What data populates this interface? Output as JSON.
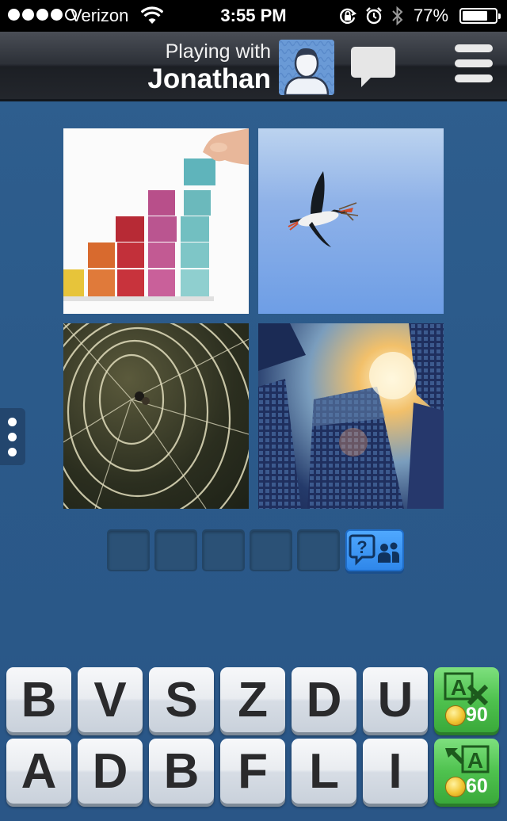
{
  "status_bar": {
    "carrier": "Verizon",
    "time": "3:55 PM",
    "battery_text": "77%",
    "battery_level": 0.77,
    "signal_dots": 4,
    "signal_total": 5
  },
  "header": {
    "playing_with_label": "Playing with",
    "opponent_name": "Jonathan",
    "icons": [
      "user-avatar-icon",
      "chat-bubble-icon",
      "menu-icon"
    ]
  },
  "puzzle": {
    "images": [
      "colored-blocks-photo",
      "stork-photo",
      "spider-web-photo",
      "skyscraper-photo"
    ],
    "answer_length": 5,
    "hint_icon": "question-people-icon"
  },
  "keyboard": {
    "row1": [
      "B",
      "V",
      "S",
      "Z",
      "D",
      "U"
    ],
    "row2": [
      "A",
      "D",
      "B",
      "F",
      "L",
      "I"
    ],
    "remove_letters_cost": "90",
    "reveal_letter_cost": "60"
  },
  "colors": {
    "background": "#2c5988",
    "powerup_green": "#4fc24f",
    "hint_blue": "#2f87ea"
  }
}
